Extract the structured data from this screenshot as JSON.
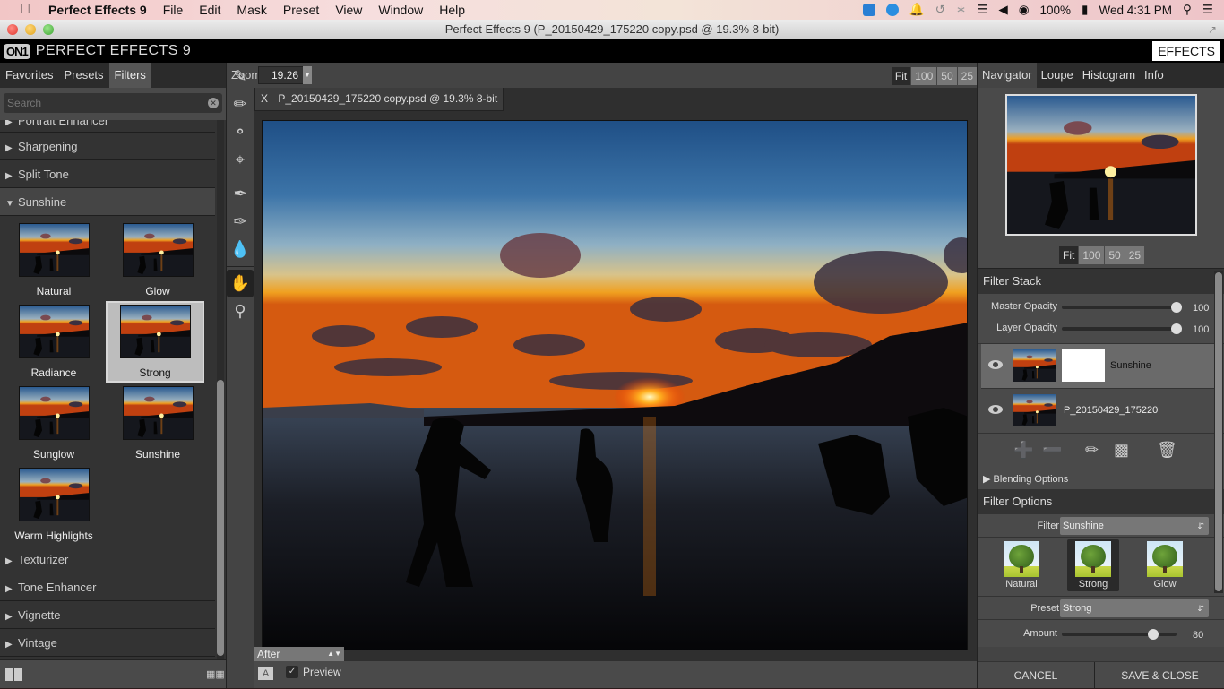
{
  "menubar": {
    "app_name": "Perfect Effects 9",
    "menus": [
      "File",
      "Edit",
      "Mask",
      "Preset",
      "View",
      "Window",
      "Help"
    ],
    "status": {
      "battery": "100%",
      "clock": "Wed 4:31 PM"
    }
  },
  "window": {
    "title": "Perfect Effects 9 (P_20150429_175220 copy.psd @ 19.3% 8-bit)"
  },
  "app_header": {
    "logo": "ON1",
    "title": "PERFECT EFFECTS 9",
    "effects_button": "EFFECTS"
  },
  "left_panel": {
    "tabs": [
      "Favorites",
      "Presets",
      "Filters"
    ],
    "active_tab": "Filters",
    "search": {
      "placeholder": "Search",
      "value": ""
    },
    "categories_above": [
      "Portrait Enhancer",
      "Sharpening",
      "Split Tone"
    ],
    "open_category": "Sunshine",
    "presets": [
      {
        "label": "Natural",
        "selected": false
      },
      {
        "label": "Glow",
        "selected": false
      },
      {
        "label": "Radiance",
        "selected": false
      },
      {
        "label": "Strong",
        "selected": true
      },
      {
        "label": "Sunglow",
        "selected": false
      },
      {
        "label": "Sunshine",
        "selected": false
      },
      {
        "label": "Warm Highlights",
        "selected": false
      }
    ],
    "categories_below": [
      "Texturizer",
      "Tone Enhancer",
      "Vignette",
      "Vintage"
    ]
  },
  "tools": [
    "masking-brush",
    "perfect-brush",
    "gradient-mask",
    "lasso-mask",
    "retouch-brush",
    "clone-stamp",
    "chisel-blur",
    "hand",
    "zoom"
  ],
  "center": {
    "zoom_label": "Zoom",
    "zoom_value": "19.26",
    "zoom_buttons": [
      "Fit",
      "100",
      "50",
      "25"
    ],
    "active_zoom": "Fit",
    "doc_tab": {
      "close": "X",
      "title": "P_20150429_175220 copy.psd @ 19.3% 8-bit"
    },
    "view_mode": "After",
    "compare_button": "A",
    "preview_label": "Preview",
    "preview_checked": true
  },
  "right_panel": {
    "tabs": [
      "Navigator",
      "Loupe",
      "Histogram",
      "Info"
    ],
    "active_tab": "Navigator",
    "nav_zoom_buttons": [
      "Fit",
      "100",
      "50",
      "25"
    ],
    "filter_stack": {
      "title": "Filter Stack",
      "master_opacity": {
        "label": "Master Opacity",
        "value": 100
      },
      "layer_opacity": {
        "label": "Layer Opacity",
        "value": 100
      },
      "layers": [
        {
          "name": "Sunshine",
          "visible": true,
          "active": true
        },
        {
          "name": "P_20150429_175220",
          "visible": true,
          "active": false
        }
      ],
      "blending_options": "Blending Options"
    },
    "filter_options": {
      "title": "Filter Options",
      "filter_label": "Filter",
      "filter_value": "Sunshine",
      "looks": [
        {
          "label": "Natural",
          "active": false
        },
        {
          "label": "Strong",
          "active": true
        },
        {
          "label": "Glow",
          "active": false
        }
      ],
      "preset_label": "Preset",
      "preset_value": "Strong",
      "amount": {
        "label": "Amount",
        "value": 80,
        "max": 100
      }
    },
    "cancel": "CANCEL",
    "save_close": "SAVE & CLOSE"
  }
}
